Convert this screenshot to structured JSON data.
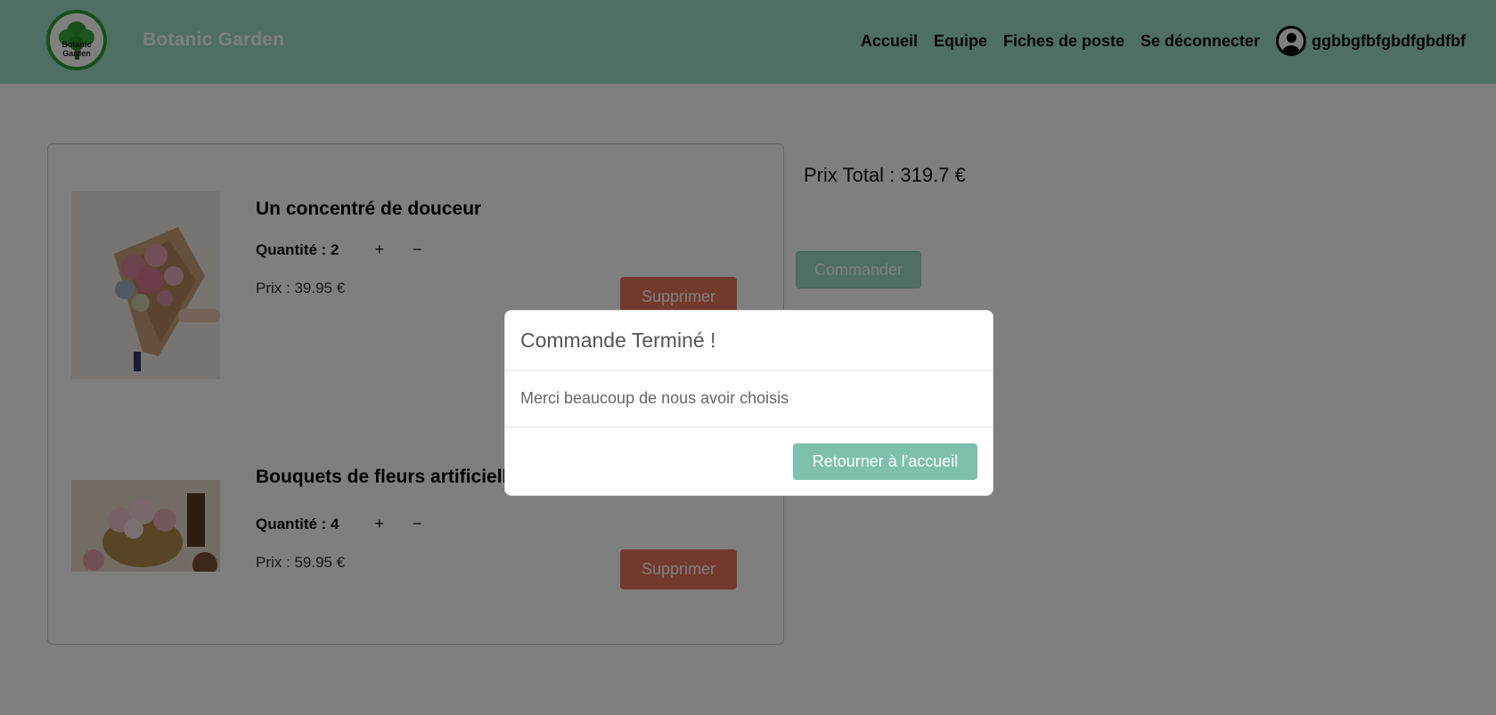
{
  "header": {
    "logo_text": "Botanic Garden",
    "brand": "Botanic Garden",
    "nav": [
      "Accueil",
      "Equipe",
      "Fiches de poste",
      "Se déconnecter"
    ],
    "username": "ggbbgfbfgbdfgbdfbf"
  },
  "cart": {
    "items": [
      {
        "title": "Un concentré de douceur",
        "quantity_label": "Quantité : 2",
        "plus": "+",
        "minus": "−",
        "price_label": "Prix : 39.95 €",
        "delete_label": "Supprimer",
        "image": "bouquet-photo"
      },
      {
        "title": "Bouquets de fleurs artificielles p",
        "quantity_label": "Quantité : 4",
        "plus": "+",
        "minus": "−",
        "price_label": "Prix : 59.95 €",
        "delete_label": "Supprimer",
        "image": "basket-bouquet-photo"
      }
    ],
    "total_label": "Prix Total : 319.7 €",
    "order_label": "Commander"
  },
  "modal": {
    "title": "Commande Terminé !",
    "message": "Merci beaucoup de nous avoir choisis",
    "button_label": "Retourner à l'accueil"
  },
  "colors": {
    "header_bg": "#9fdcc9",
    "delete_button": "#e8735a",
    "order_button": "#9fdcc9",
    "modal_button": "#7cc0ad",
    "logo_ring": "#2f9e33"
  },
  "icons": [
    "tree-logo-icon",
    "user-avatar-icon"
  ]
}
